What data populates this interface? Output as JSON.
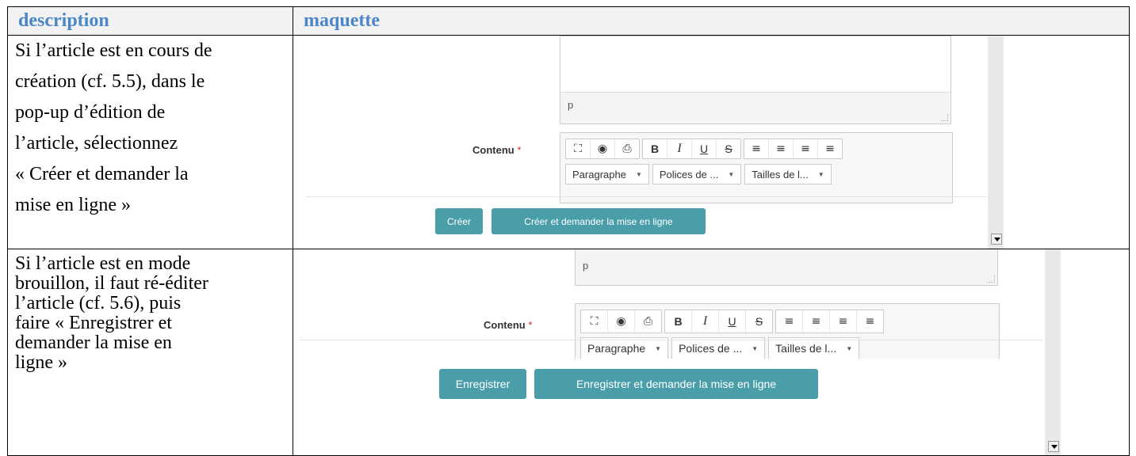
{
  "table": {
    "header_description": "description",
    "header_maquette": "maquette"
  },
  "row1": {
    "description_lines": [
      "Si l’article est en cours de",
      "création (cf. 5.5), dans le",
      "pop-up d’édition de",
      "l’article, sélectionnez",
      "« Créer  et demander la",
      "mise  en ligne »"
    ],
    "mock": {
      "textarea_status": "p",
      "content_label": "Contenu",
      "required_mark": "*",
      "dropdown_paragraph": "Paragraphe",
      "dropdown_fonts": "Polices de ...",
      "dropdown_sizes": "Tailles de l...",
      "button_create": "Créer",
      "button_create_publish": "Créer et demander la mise en ligne"
    }
  },
  "row2": {
    "description_lines": [
      "Si l’article est en mode",
      "brouillon, il faut ré-éditer",
      "l’article (cf. 5.6), puis",
      "faire « Enregistrer et",
      "demander la mise en",
      "ligne »"
    ],
    "mock": {
      "textarea_status": "p",
      "content_label": "Contenu",
      "required_mark": "*",
      "dropdown_paragraph": "Paragraphe",
      "dropdown_fonts": "Polices de ...",
      "dropdown_sizes": "Tailles de l...",
      "button_save": "Enregistrer",
      "button_save_publish": "Enregistrer et demander la mise en ligne"
    }
  },
  "toolbar_icons": [
    "fullscreen-icon",
    "preview-eye-icon",
    "print-icon",
    "bold-icon",
    "italic-icon",
    "underline-icon",
    "strikethrough-icon",
    "align-left-icon",
    "align-center-icon",
    "align-right-icon",
    "align-justify-icon"
  ],
  "toolbar_glyphs": {
    "fullscreen": "⛶",
    "preview": "◉",
    "print": "⎙",
    "bold": "B",
    "italic": "I",
    "underline": "U",
    "strike": "S",
    "align_left": "≡",
    "align_center": "≡",
    "align_right": "≡",
    "align_justify": "≡"
  },
  "colors": {
    "header_text": "#4a86c8",
    "button_bg": "#4a9eaa",
    "required": "#c9302c"
  }
}
